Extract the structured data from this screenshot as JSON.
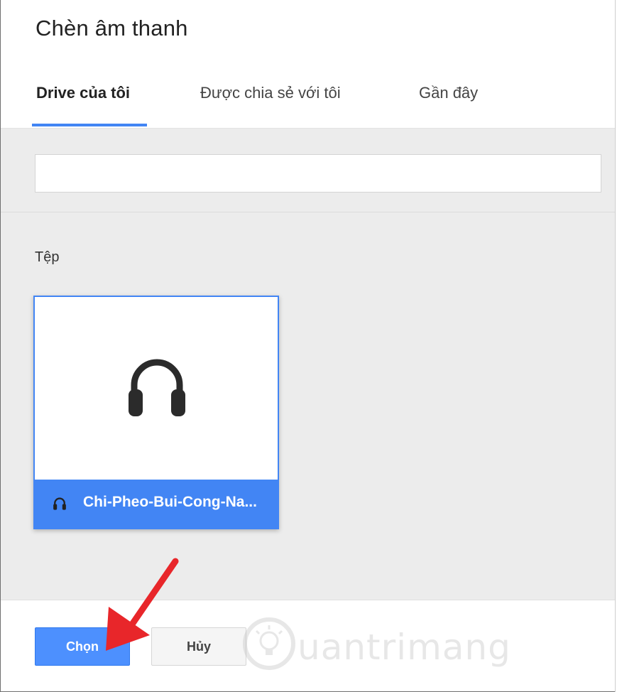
{
  "dialog": {
    "title": "Chèn âm thanh"
  },
  "tabs": [
    {
      "label": "Drive của tôi",
      "active": true
    },
    {
      "label": "Được chia sẻ với tôi",
      "active": false
    },
    {
      "label": "Gần đây",
      "active": false
    }
  ],
  "search": {
    "value": "",
    "placeholder": ""
  },
  "files": {
    "section_label": "Tệp",
    "items": [
      {
        "name": "Chi-Pheo-Bui-Cong-Na...",
        "icon": "headphones-icon",
        "selected": true
      }
    ]
  },
  "footer": {
    "choose_label": "Chọn",
    "cancel_label": "Hủy"
  },
  "watermark": {
    "text": "uantrimang",
    "logo": "Quantrimang"
  },
  "colors": {
    "accent": "#4285f4",
    "primary_button": "#4d90fe",
    "content_bg": "#ececec",
    "annotation_arrow": "#e8262a"
  }
}
